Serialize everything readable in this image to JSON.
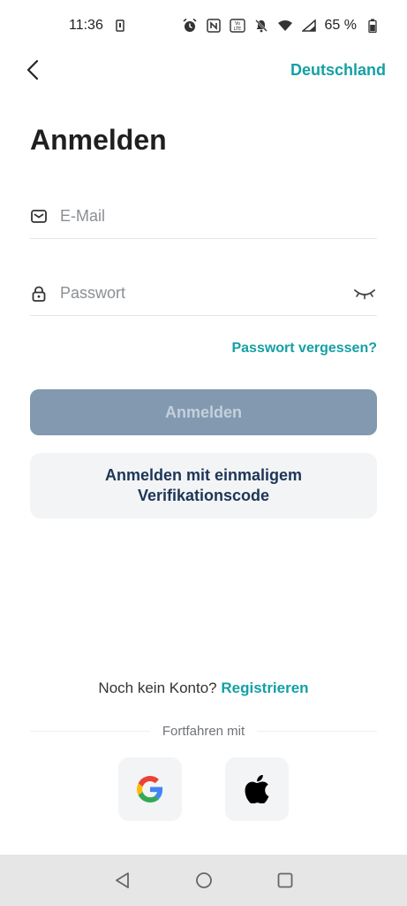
{
  "status_bar": {
    "time": "11:36",
    "battery_text": "65 %"
  },
  "nav": {
    "back_icon": "chevron-left-icon",
    "region": "Deutschland"
  },
  "page": {
    "title": "Anmelden"
  },
  "form": {
    "email_placeholder": "E-Mail",
    "email_value": "",
    "password_placeholder": "Passwort",
    "password_value": "",
    "forgot_password": "Passwort vergessen?",
    "login_button": "Anmelden",
    "otp_button": "Anmelden mit einmaligem Verifikationscode"
  },
  "register": {
    "prompt": "Noch kein Konto?",
    "link": "Registrieren"
  },
  "social": {
    "continue_with": "Fortfahren mit",
    "providers": [
      "google-icon",
      "apple-icon"
    ]
  },
  "colors": {
    "accent": "#14a0a5",
    "login_disabled_bg": "#8299b0",
    "otp_text": "#1d3557",
    "secondary_bg": "#f2f4f6"
  }
}
